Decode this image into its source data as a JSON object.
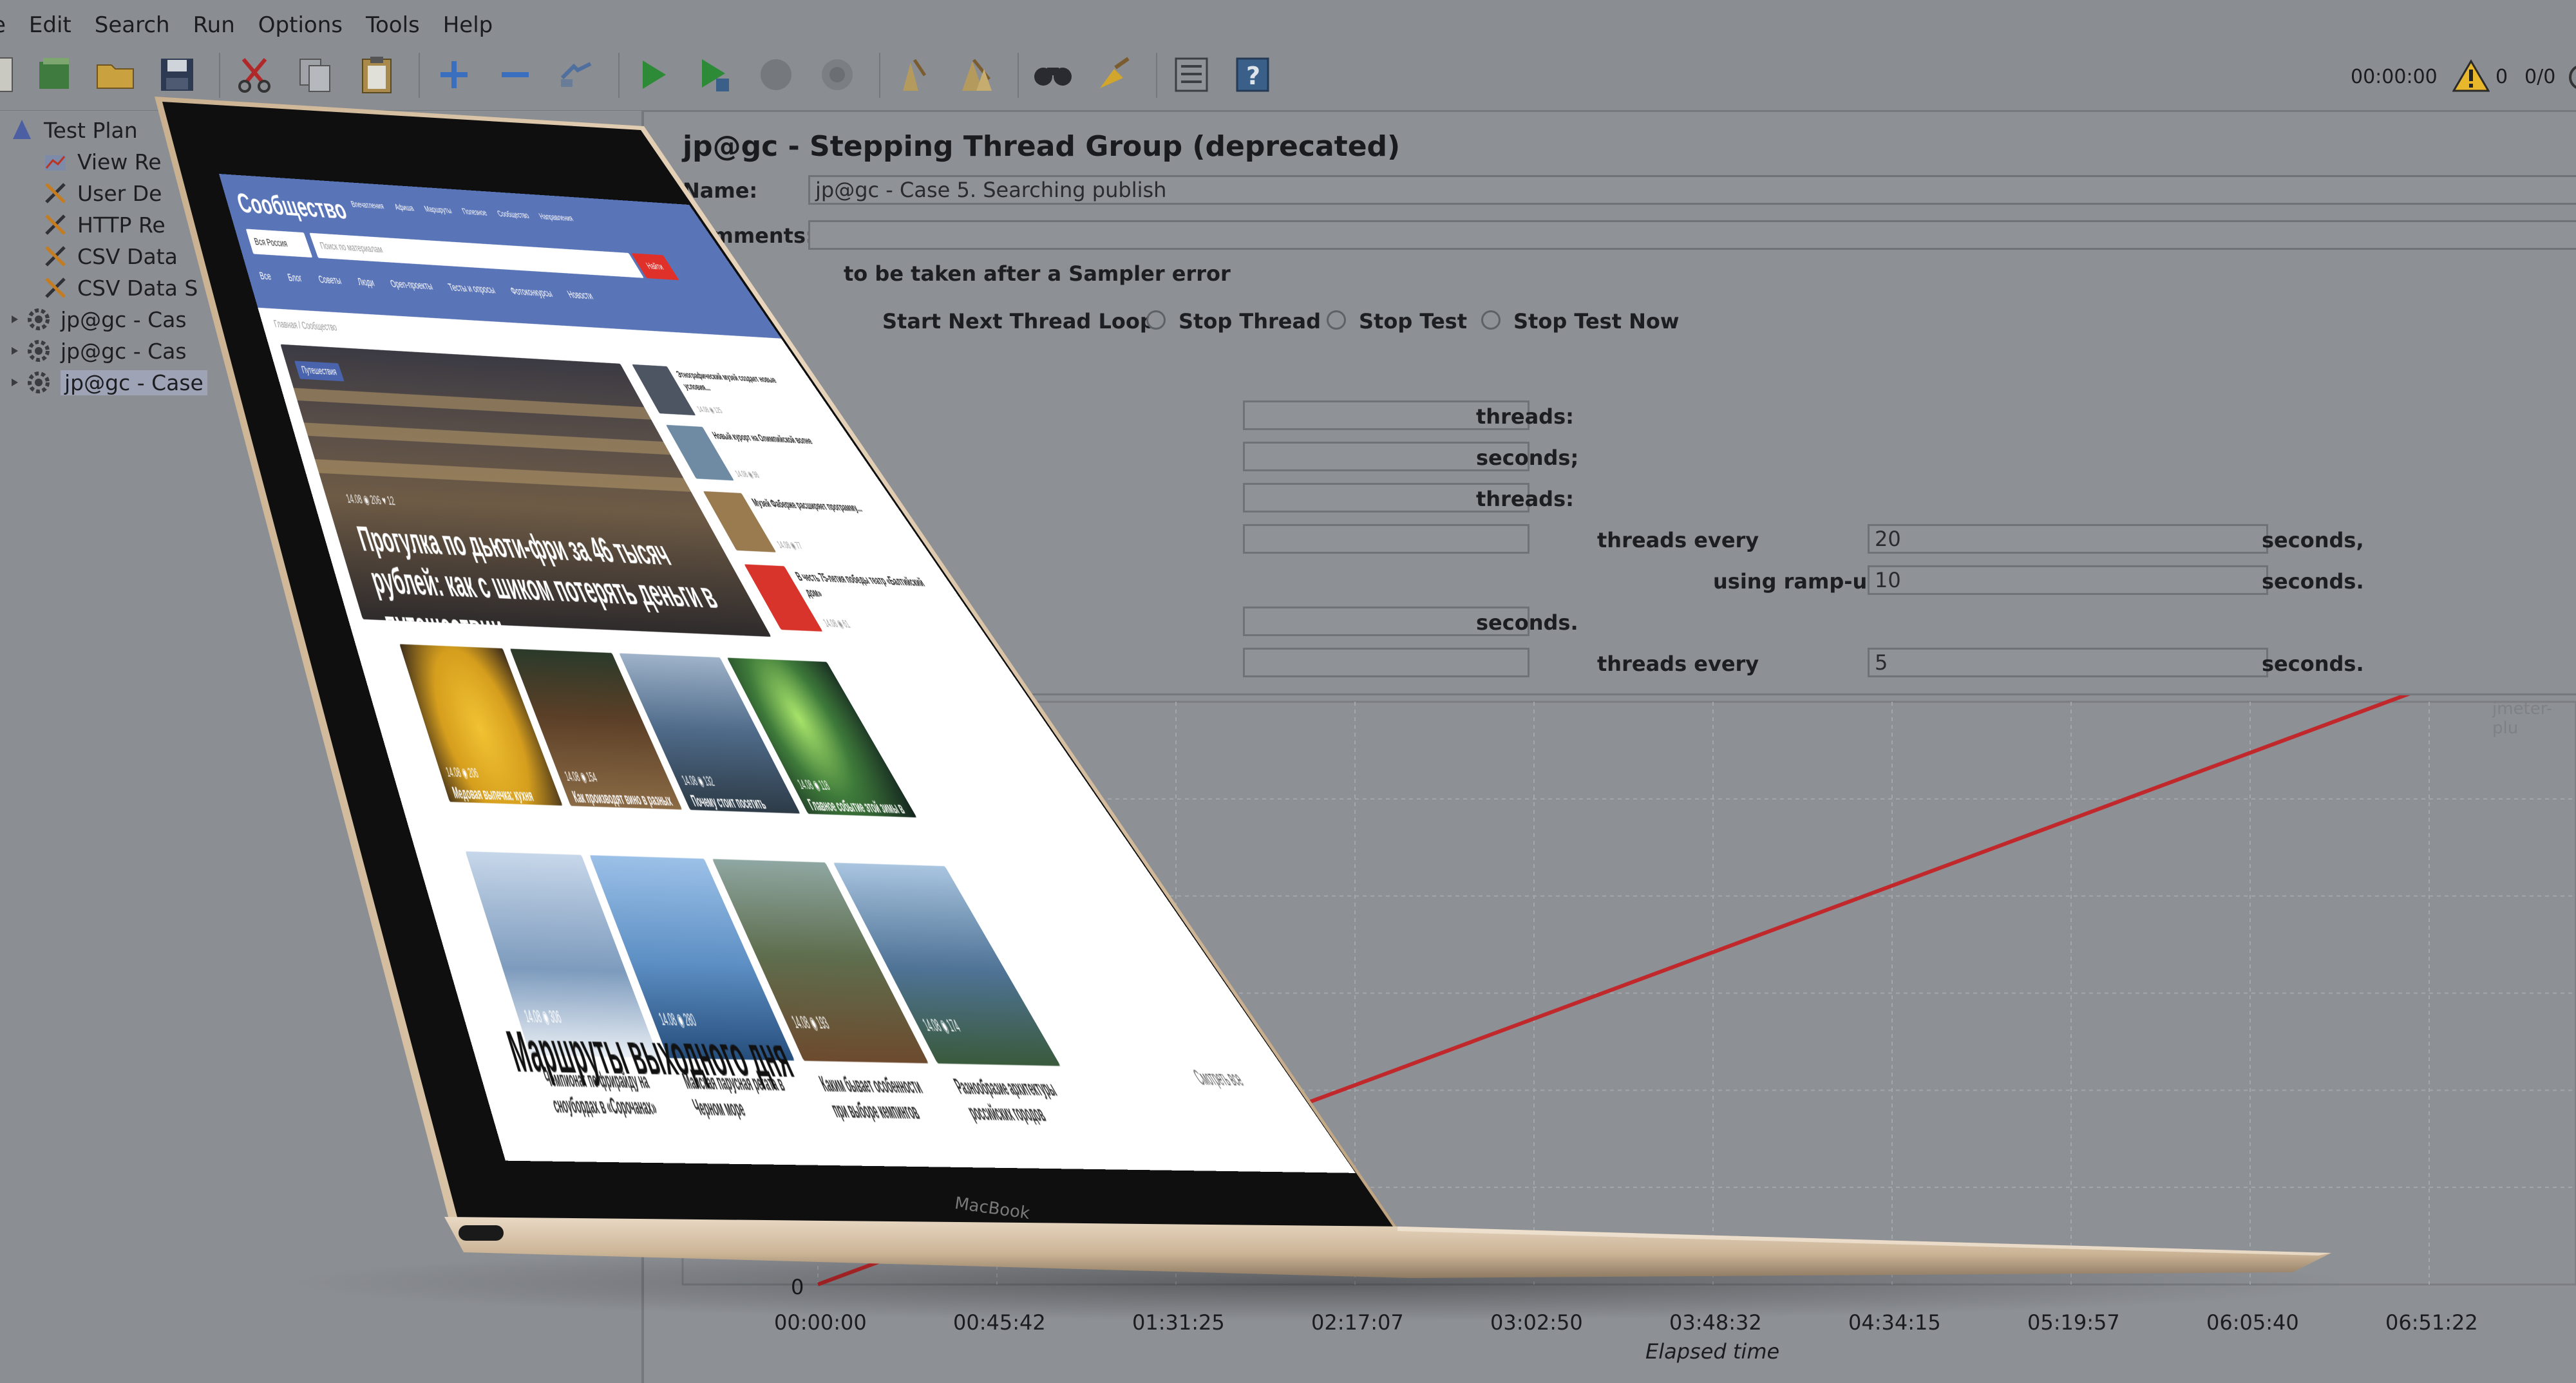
{
  "menubar": {
    "items": [
      "e",
      "Edit",
      "Search",
      "Run",
      "Options",
      "Tools",
      "Help"
    ]
  },
  "status": {
    "timer": "00:00:00",
    "warnings": "0",
    "threads": "0/0"
  },
  "tree": {
    "items": [
      {
        "label": "Test Plan"
      },
      {
        "label": "View Re"
      },
      {
        "label": "User De"
      },
      {
        "label": "HTTP Re"
      },
      {
        "label": "CSV Data"
      },
      {
        "label": "CSV Data S"
      },
      {
        "label": "jp@gc - Cas"
      },
      {
        "label": "jp@gc - Cas"
      },
      {
        "label": "jp@gc - Case"
      }
    ]
  },
  "panel": {
    "title": "jp@gc - Stepping Thread Group (deprecated)",
    "name_label": "Name:",
    "name_value": "jp@gc - Case 5. Searching publish",
    "comments_label": "Comments:",
    "sampler_error": "to be taken after a Sampler error",
    "radio_start_next": "Start Next Thread Loop",
    "radio_stop_thread": "Stop Thread",
    "radio_stop_test": "Stop Test",
    "radio_stop_now": "Stop Test Now",
    "threads_1": "threads:",
    "seconds_1": "seconds;",
    "threads_2": "threads:",
    "threads_every_1": "threads every",
    "value_every_1": "20",
    "seconds_2": "seconds,",
    "using_rampup": "using ramp-up",
    "value_rampup": "10",
    "seconds_3": "seconds.",
    "seconds_4": "seconds.",
    "threads_every_2": "threads every",
    "value_every_2": "5",
    "seconds_5": "seconds.",
    "watermark": "jmeter-plu"
  },
  "chart_data": {
    "type": "line",
    "xlabel": "Elapsed time",
    "ylabel": "",
    "x_ticks": [
      "00:00:00",
      "00:45:42",
      "01:31:25",
      "02:17:07",
      "03:02:50",
      "03:48:32",
      "04:34:15",
      "05:19:57",
      "06:05:40",
      "06:51:22"
    ],
    "y_ticks": [
      "0"
    ],
    "series": [
      {
        "color": "#c0282b",
        "x": [
          "00:00:00",
          "07:05:00"
        ],
        "y": [
          0,
          100
        ]
      }
    ]
  },
  "site": {
    "logo": "Сообщество",
    "nav": [
      "Впечатления",
      "Афиша",
      "Маршруты",
      "Полезное",
      "Сообщество",
      "Направления"
    ],
    "region": "Вся Россия",
    "search_placeholder": "Поиск по материалам",
    "search_button": "Найти",
    "cats": [
      "Все",
      "Блог",
      "Советы",
      "Люди",
      "Open-проекты",
      "Тесты и опросы",
      "Фотоконкурсы",
      "Новости"
    ],
    "breadcrumb": "Главная / Сообщество",
    "hero_badge": "Путешествия",
    "hero_meta": "14.08  ◉ 206  ♥ 12",
    "hero_title": "Прогулка по дьюти-фри за 46 тысяч рублей: как с шиком потерять деньги в путешествии",
    "side": [
      {
        "title": "Этнографический музей создает новые условия...",
        "meta": "14.08  ◉ 125"
      },
      {
        "title": "Новый курорт на Олимпийской волне",
        "meta": "14.08  ◉ 98"
      },
      {
        "title": "Музей Фаберже расширяет программу...",
        "meta": "14.08  ◉ 77"
      },
      {
        "title": "В честь 75-летия победы театр «Балтийский дом»",
        "meta": "14.08  ◉ 61"
      }
    ],
    "cards": [
      {
        "title": "Медовая выпечка: кухня Татарстана",
        "meta": "14.08  ◉ 206"
      },
      {
        "title": "Как производят вино в разных частях России",
        "meta": "14.08  ◉ 154"
      },
      {
        "title": "Почему стоит посетить Петербург этим летом",
        "meta": "14.08  ◉ 132"
      },
      {
        "title": "Главное событие этой зимы в Мурманске «Охота за сиянием»",
        "meta": "14.08  ◉ 118"
      },
      {
        "title": "Чемпионат по фрирайду на сноубордах в «Сорочанах»",
        "meta": "14.08  ◉ 306"
      },
      {
        "title": "Майская парусная регата в Черном море",
        "meta": "14.08  ◉ 280"
      },
      {
        "title": "Каким бывает особенности при выборе кемпингов",
        "meta": "14.08  ◉ 193"
      },
      {
        "title": "Разнообразие архитектуры российских городов",
        "meta": "14.08  ◉ 174"
      }
    ],
    "bottom_heading": "Маршруты выходного дня",
    "see_all": "Смотреть все"
  },
  "laptop": {
    "brand": "MacBook"
  }
}
